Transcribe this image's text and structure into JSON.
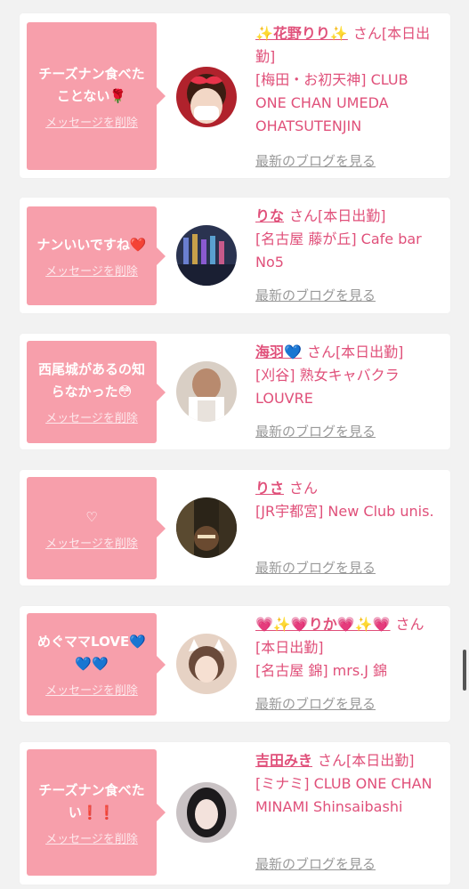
{
  "cards": [
    {
      "message": "チーズナン食べたことない🌹",
      "delete_label": "メッセージを削除",
      "name": "✨花野りり✨",
      "suffix": "さん[本日出勤]",
      "shop": "[梅田・お初天神] CLUB ONE CHAN UMEDA OHATSUTENJIN",
      "blog_label": "最新のブログを見る"
    },
    {
      "message": "ナンいいですね❤️",
      "delete_label": "メッセージを削除",
      "name": "りな",
      "suffix": "さん[本日出勤]",
      "shop": "[名古屋 藤が丘] Cafe bar No5",
      "blog_label": "最新のブログを見る"
    },
    {
      "message": "西尾城があるの知らなかった😳",
      "delete_label": "メッセージを削除",
      "name": "海羽💙",
      "suffix": "さん[本日出勤]",
      "shop": "[刈谷] 熟女キャバクラ LOUVRE",
      "blog_label": "最新のブログを見る"
    },
    {
      "message": "♡",
      "delete_label": "メッセージを削除",
      "name": "りさ",
      "suffix": "さん",
      "shop": "[JR宇都宮] New Club unis.",
      "blog_label": "最新のブログを見る"
    },
    {
      "message": "めぐママLOVE💙💙💙",
      "delete_label": "メッセージを削除",
      "name": "💗✨💗りか💗✨💗",
      "suffix": "さん[本日出勤]",
      "shop": "[名古屋 錦] mrs.J 錦",
      "blog_label": "最新のブログを見る"
    },
    {
      "message": "チーズナン食べたい❗️❗️",
      "delete_label": "メッセージを削除",
      "name": "吉田みき",
      "suffix": "さん[本日出勤]",
      "shop": "[ミナミ] CLUB ONE CHAN MINAMI Shinsaibashi",
      "blog_label": "最新のブログを見る"
    }
  ],
  "avatars": [
    {
      "icon": "woman-red-bow-mask-photo",
      "color": "#b0222c"
    },
    {
      "icon": "bar-bottles-photo",
      "color": "#2a3350"
    },
    {
      "icon": "woman-apron-photo",
      "color": "#d9cfc5"
    },
    {
      "icon": "night-city-selfie-photo",
      "color": "#2b2418"
    },
    {
      "icon": "woman-cat-ears-photo",
      "color": "#e6d2c4"
    },
    {
      "icon": "woman-dark-hair-photo",
      "color": "#c9c2c4"
    }
  ],
  "colors": {
    "accent_pink": "#f79fab",
    "name_pink": "#e0507a",
    "blog_gray": "#999999"
  }
}
